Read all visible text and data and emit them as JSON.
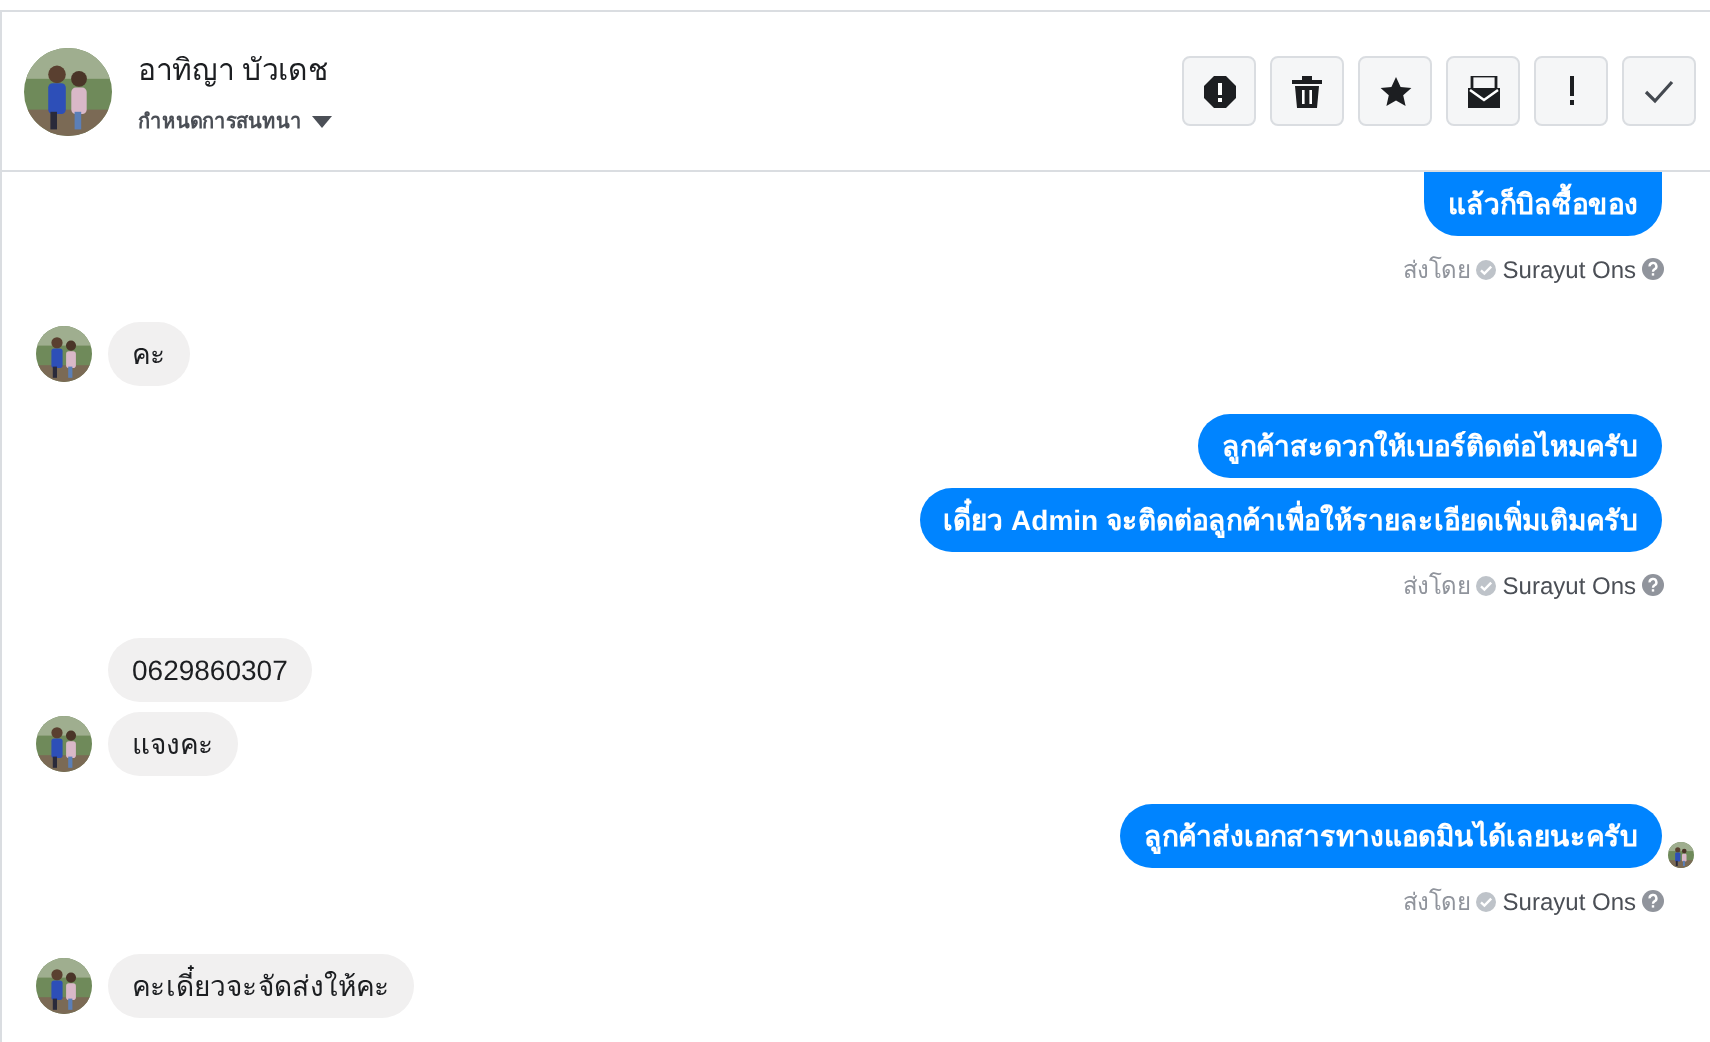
{
  "header": {
    "name": "อาทิญา บัวเดช",
    "subtitle": "กำหนดการสนทนา",
    "actions": [
      {
        "kind": "alert"
      },
      {
        "kind": "trash"
      },
      {
        "kind": "star"
      },
      {
        "kind": "inbox"
      },
      {
        "kind": "exclamation"
      },
      {
        "kind": "done"
      }
    ]
  },
  "messages": [
    {
      "kind": "outgoing",
      "bubbles": [
        "แล้วก็บิลซื้อของ"
      ],
      "clipped_top": true,
      "sent_by_label": "ส่งโดย",
      "sender": "Surayut Ons",
      "seen": false
    },
    {
      "kind": "incoming",
      "bubbles": [
        "คะ"
      ]
    },
    {
      "kind": "outgoing",
      "bubbles": [
        "ลูกค้าสะดวกให้เบอร์ติดต่อไหมครับ",
        "เดี๋ยว Admin จะติดต่อลูกค้าเพื่อให้รายละเอียดเพิ่มเติมครับ"
      ],
      "sent_by_label": "ส่งโดย",
      "sender": "Surayut Ons",
      "seen": false
    },
    {
      "kind": "incoming",
      "bubbles": [
        "0629860307",
        "แจงคะ"
      ]
    },
    {
      "kind": "outgoing",
      "bubbles": [
        "ลูกค้าส่งเอกสารทางแอดมินได้เลยนะครับ"
      ],
      "sent_by_label": "ส่งโดย",
      "sender": "Surayut Ons",
      "seen": true
    },
    {
      "kind": "incoming",
      "bubbles": [
        "คะเดี๋ยวจะจัดส่งให้คะ"
      ]
    }
  ]
}
